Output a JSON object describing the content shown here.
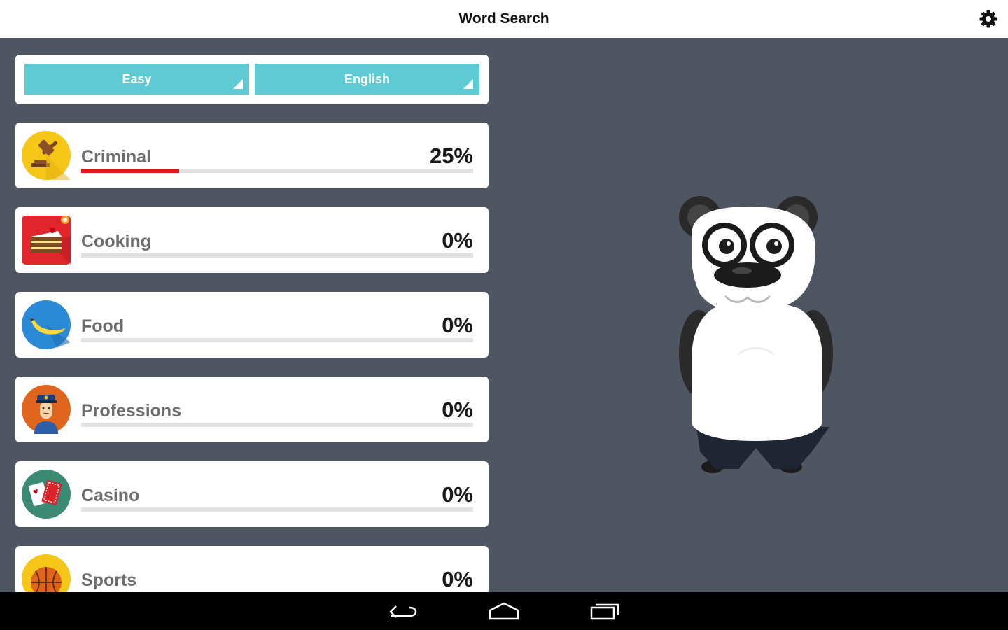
{
  "app": {
    "title": "Word Search"
  },
  "filters": {
    "level": "Easy",
    "language": "English"
  },
  "colors": {
    "accent": "#5ecbd4",
    "progress": "#e3141c",
    "background": "#4f5561"
  },
  "categories": [
    {
      "label": "Criminal",
      "percent_text": "25%",
      "progress": 0.25,
      "icon": "gavel-icon"
    },
    {
      "label": "Cooking",
      "percent_text": "0%",
      "progress": 0,
      "icon": "cake-icon"
    },
    {
      "label": "Food",
      "percent_text": "0%",
      "progress": 0,
      "icon": "banana-icon"
    },
    {
      "label": "Professions",
      "percent_text": "0%",
      "progress": 0,
      "icon": "police-officer-icon"
    },
    {
      "label": "Casino",
      "percent_text": "0%",
      "progress": 0,
      "icon": "playing-cards-icon"
    },
    {
      "label": "Sports",
      "percent_text": "0%",
      "progress": 0,
      "icon": "basketball-icon"
    }
  ],
  "navigation": {
    "back": "back-icon",
    "home": "home-icon",
    "recents": "recents-icon"
  }
}
